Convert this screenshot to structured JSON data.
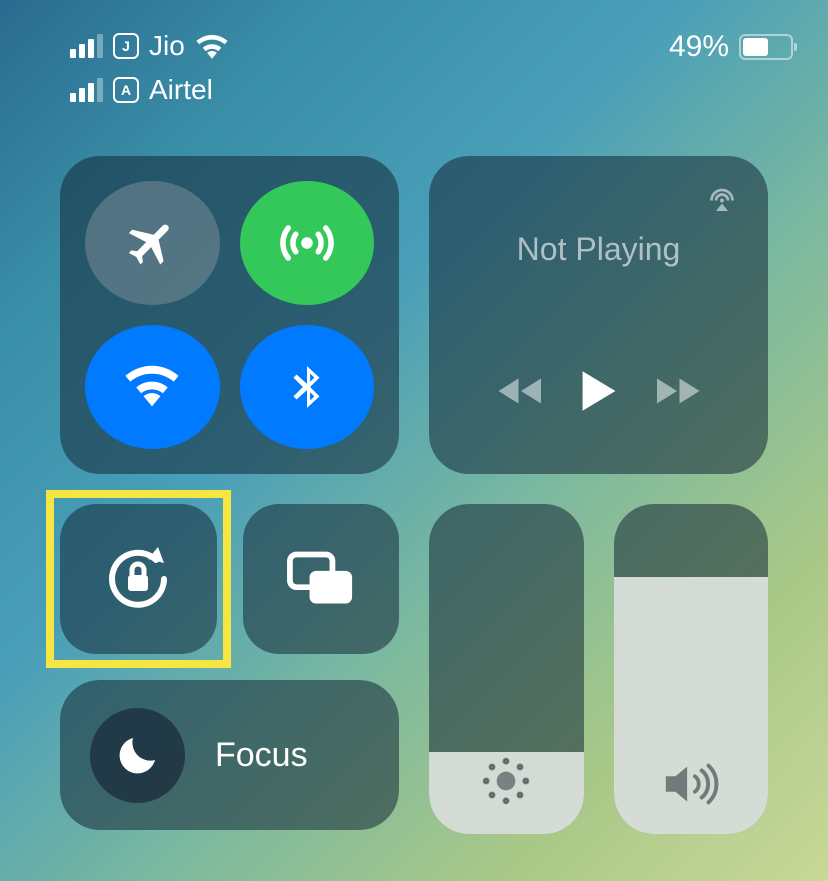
{
  "status": {
    "carrier1": {
      "badge": "J",
      "name": "Jio",
      "bars": 3
    },
    "carrier2": {
      "badge": "A",
      "name": "Airtel",
      "bars": 3
    },
    "battery_pct_label": "49%",
    "battery_pct": 49
  },
  "connectivity": {
    "airplane": {
      "active": false
    },
    "cellular": {
      "active": true
    },
    "wifi": {
      "active": true
    },
    "bluetooth": {
      "active": true
    }
  },
  "media": {
    "title": "Not Playing"
  },
  "focus": {
    "label": "Focus"
  },
  "sliders": {
    "brightness_pct": 25,
    "volume_pct": 78
  },
  "highlight_target": "orientation-lock"
}
